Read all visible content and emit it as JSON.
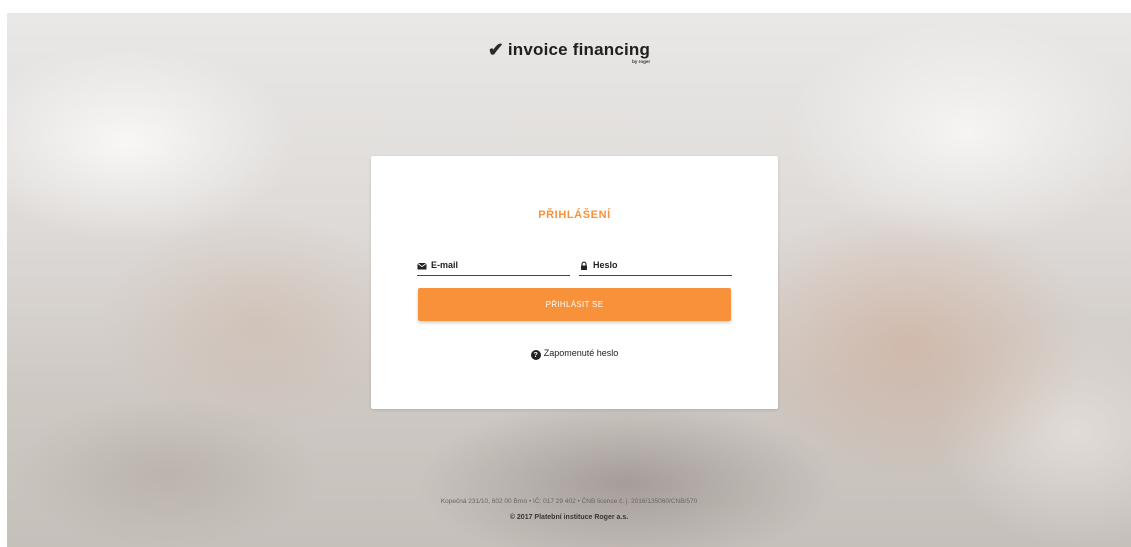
{
  "logo": {
    "title": "invoice financing",
    "subtitle": "by roger"
  },
  "login": {
    "title": "PŘIHLÁŠENÍ",
    "email_label": "E-mail",
    "password_label": "Heslo",
    "submit_label": "PŘIHLÁSIT SE",
    "forgot_label": "Zapomenuté heslo"
  },
  "footer": {
    "address": "Kopečná 231/10, 602 00 Brno • IČ: 017 29 402 • ČNB licence č. j. 2016/135060/CNB/570",
    "copyright": "© 2017 Platební instituce Roger a.s."
  },
  "colors": {
    "accent": "#f7913a",
    "text": "#222222",
    "card": "#ffffff"
  },
  "icons": {
    "logo": "check-icon",
    "email": "envelope-icon",
    "password": "lock-icon",
    "forgot": "question-circle-icon"
  }
}
